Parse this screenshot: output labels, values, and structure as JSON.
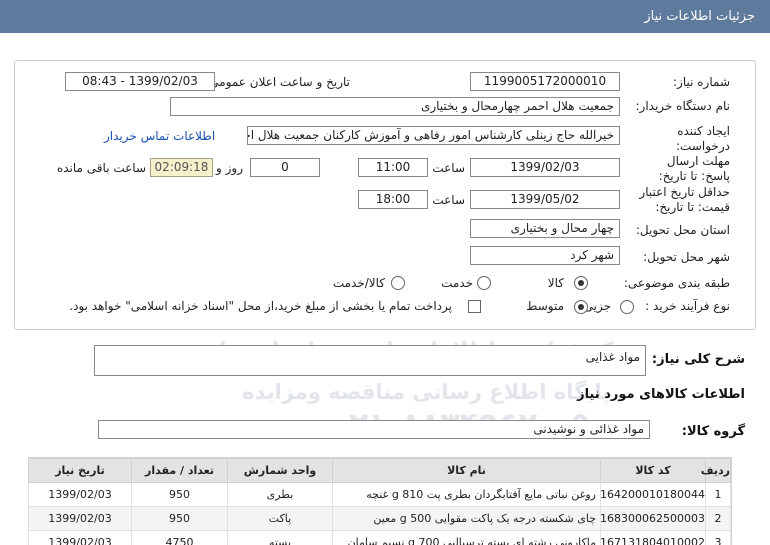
{
  "header": {
    "title": "جزئیات اطلاعات نیاز"
  },
  "form": {
    "need_number_label": "شماره نیاز:",
    "need_number": "1199005172000010",
    "announce_label": "تاریخ و ساعت اعلان عمومی:",
    "announce_value": "1399/02/03 - 08:43",
    "buyer_org_label": "نام دستگاه خریدار:",
    "buyer_org": "جمعیت هلال احمر چهارمحال و بختیاری",
    "creator_label": "ایجاد کننده درخواست:",
    "creator": "خیرالله حاج زینلی کارشناس امور رفاهی و آموزش کارکنان جمعیت هلال احمر چا",
    "contact_link": "اطلاعات تماس خریدار",
    "reply_deadline_label": "مهلت ارسال پاسخ: تا تاریخ:",
    "reply_date": "1399/02/03",
    "time_label": "ساعت",
    "reply_time": "11:00",
    "days_label": "روز و",
    "days": "0",
    "remaining_time": "02:09:18",
    "remaining_label": "ساعت باقی مانده",
    "price_validity_label": "حداقل تاریخ اعتبار قیمت: تا تاریخ:",
    "price_date": "1399/05/02",
    "price_time": "18:00",
    "province_label": "استان محل تحویل:",
    "province": "چهار محال و بختیاری",
    "city_label": "شهر محل تحویل:",
    "city": "شهر کرد",
    "category_label": "طبقه بندی موضوعی:",
    "category_options": [
      "کالا",
      "خدمت",
      "کالا/خدمت"
    ],
    "category_selected": 0,
    "process_label": "نوع فرآیند خرید :",
    "process_options": [
      "جزیی",
      "متوسط"
    ],
    "process_selected": 1,
    "payment_note": "پرداخت تمام یا بخشی از مبلغ خرید،از محل \"اسناد خزانه اسلامی\" خواهد بود."
  },
  "summary": {
    "label": "شرح کلی نیاز:",
    "value": "مواد غذایی"
  },
  "goods_section_title": "اطلاعات کالاهای مورد نیاز",
  "goods_group": {
    "label": "گروه کالا:",
    "value": "مواد غذائی و نوشیدنی"
  },
  "table": {
    "headers": [
      "ردیف",
      "کد کالا",
      "نام کالا",
      "واحد شمارش",
      "تعداد / مقدار",
      "تاریخ نیاز"
    ],
    "rows": [
      [
        "1",
        "0164200010180044",
        "روغن نباتی مایع آفتابگردان بطری پت 810 g غنچه",
        "بطری",
        "950",
        "1399/02/03"
      ],
      [
        "2",
        "0168300062500003",
        "چای شکسته درجه یک پاکت مقوایی 500 g معین",
        "پاکت",
        "950",
        "1399/02/03"
      ],
      [
        "3",
        "0167131804010002",
        "ماکارونی رشته ای بسته ترسیالبی 700 g نسیم سامان",
        "بسته",
        "4750",
        "1399/02/03"
      ]
    ]
  },
  "watermark": {
    "line1": "مرکز فراوری اطلاعات پارس نماد داده ها",
    "line2": "پایگاه اطلاع رسانی مناقصه ومزایده",
    "line3": "۰۲۱-۸۸۳۴۹۶۷۰-۵"
  },
  "colors": {
    "titlebar": "#5e7a9d",
    "link": "#1a4fb3",
    "time_bg": "#f6f0cc"
  }
}
